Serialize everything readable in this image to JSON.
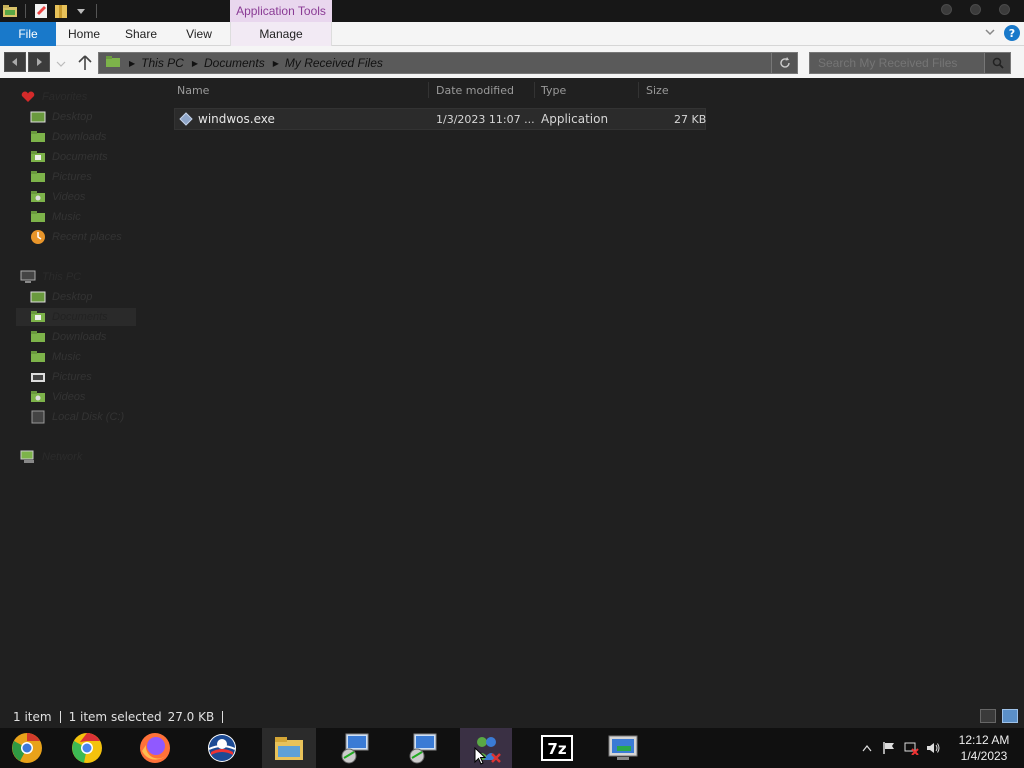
{
  "ribbon": {
    "context_group": "Application Tools",
    "tabs": [
      "File",
      "Home",
      "Share",
      "View",
      "Manage"
    ]
  },
  "address": {
    "crumbs": [
      "This PC",
      "Documents",
      "My Received Files"
    ],
    "search_placeholder": "Search My Received Files"
  },
  "nav": {
    "favorites": {
      "label": "Favorites",
      "items": [
        "Desktop",
        "Downloads",
        "Documents",
        "Pictures",
        "Videos",
        "Music",
        "Recent places"
      ]
    },
    "this_pc": {
      "label": "This PC",
      "items": [
        "Desktop",
        "Documents",
        "Downloads",
        "Music",
        "Pictures",
        "Videos",
        "Local Disk (C:)"
      ]
    },
    "network": {
      "label": "Network"
    }
  },
  "files": {
    "columns": {
      "name": "Name",
      "date": "Date modified",
      "type": "Type",
      "size": "Size"
    },
    "rows": [
      {
        "name": "windwos.exe",
        "date": "1/3/2023 11:07 ...",
        "type": "Application",
        "size": "27 KB"
      }
    ]
  },
  "status": {
    "count": "1 item",
    "selection": "1 item selected",
    "selection_size": "27.0 KB"
  },
  "taskbar": {
    "apps": [
      "chrome-canary",
      "chrome",
      "firefox",
      "obama-app",
      "file-explorer",
      "setup-app-1",
      "setup-app-2",
      "msn-messenger",
      "7zip",
      "monitor-app"
    ],
    "time": "12:12 AM",
    "date": "1/4/2023"
  },
  "colors": {
    "file_tab": "#1979ca",
    "context_tab": "#e9d7ee",
    "context_text": "#8a3b95"
  }
}
